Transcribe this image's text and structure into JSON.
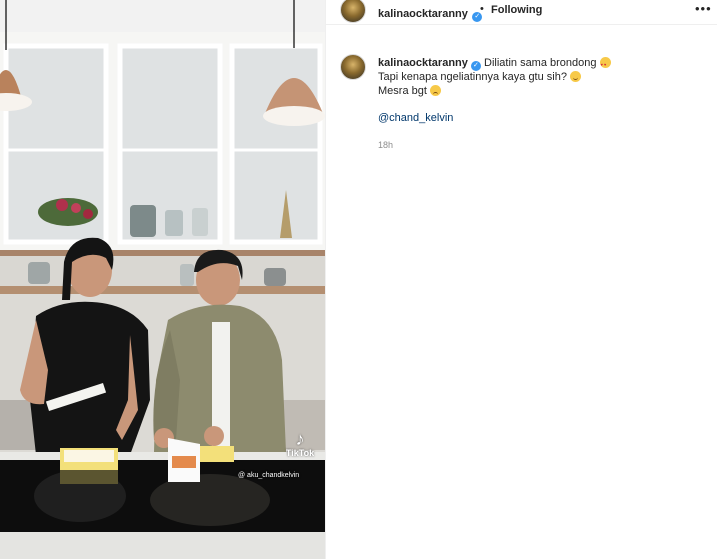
{
  "post": {
    "username": "kalinaocktaranny",
    "separator": "•",
    "follow_status": "Following",
    "more_icon": "more-horizontal-icon",
    "caption": {
      "line1": "Diliatin sama brondong",
      "line2": "Tapi kenapa ngeliatinnya kaya gtu sih?",
      "line3": "Mesra bgt",
      "mention": "@chand_kelvin"
    },
    "time": "18h"
  },
  "media": {
    "watermark_brand": "TikTok",
    "watermark_handle": "@ aku_chandkelvin"
  },
  "colors": {
    "verified": "#3897f0",
    "mention": "#00376b",
    "muted": "#8e8e8e"
  }
}
